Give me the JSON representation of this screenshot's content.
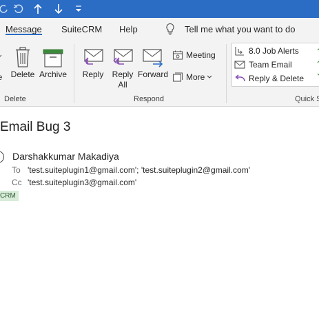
{
  "quick_access": {
    "icons": [
      "undo-icon",
      "redo-icon",
      "up-arrow-icon",
      "down-arrow-icon",
      "customize-qat-icon"
    ]
  },
  "tabs": [
    {
      "label": "Message",
      "active": true
    },
    {
      "label": "SuiteCRM",
      "active": false
    },
    {
      "label": "Help",
      "active": false
    }
  ],
  "tell_me": {
    "placeholder": "Tell me what you want to do"
  },
  "ribbon": {
    "delete_group": {
      "label": "Delete",
      "buttons": {
        "delete": "Delete",
        "archive": "Archive"
      },
      "partial_left": "e"
    },
    "respond_group": {
      "label": "Respond",
      "buttons": {
        "reply": "Reply",
        "reply_all_line1": "Reply",
        "reply_all_line2": "All",
        "forward": "Forward",
        "meeting": "Meeting",
        "more": "More"
      }
    },
    "quick_steps_group": {
      "label": "Quick S",
      "items": [
        "8.0 Job Alerts",
        "Team Email",
        "Reply & Delete"
      ]
    }
  },
  "message": {
    "subject": "Email Bug 3",
    "sender": "Darshakkumar Makadiya",
    "to_label": "To",
    "to_value": "'test.suiteplugin1@gmail.com'; 'test.suiteplugin2@gmail.com'",
    "cc_label": "Cc",
    "cc_value": "'test.suiteplugin3@gmail.com'",
    "category_badge": "CRM"
  },
  "colors": {
    "title_bar": "#2b6cc4",
    "ribbon_bg": "#f3f3f3",
    "reply_purple": "#8a4fb8",
    "forward_blue": "#2b6cc4",
    "archive_green": "#3a8a3a",
    "crm_badge_bg": "#d8ecd9"
  }
}
